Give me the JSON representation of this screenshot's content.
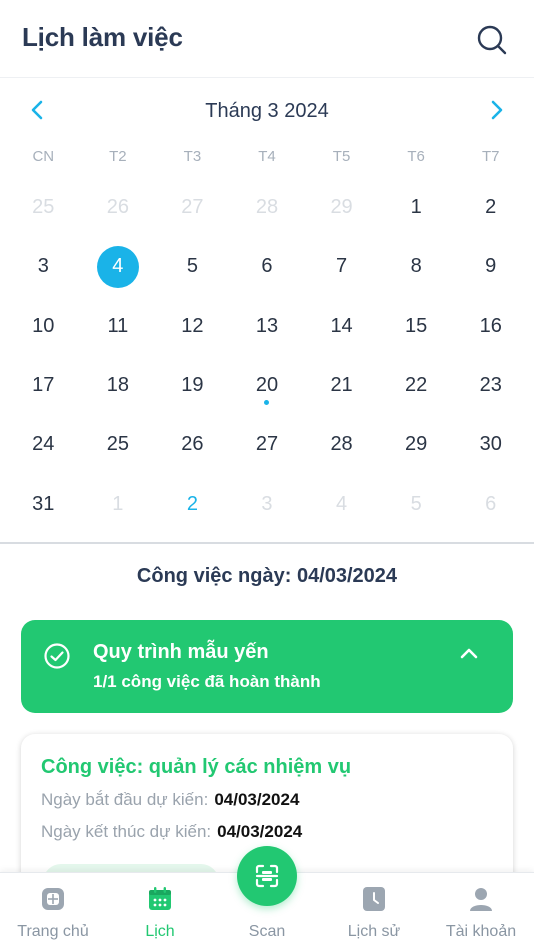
{
  "header": {
    "title": "Lịch làm việc",
    "search_icon": "search-icon"
  },
  "calendar": {
    "month_label": "Tháng 3 2024",
    "weekdays": [
      "CN",
      "T2",
      "T3",
      "T4",
      "T5",
      "T6",
      "T7"
    ],
    "days": [
      {
        "label": "25",
        "state": "muted"
      },
      {
        "label": "26",
        "state": "muted"
      },
      {
        "label": "27",
        "state": "muted"
      },
      {
        "label": "28",
        "state": "muted"
      },
      {
        "label": "29",
        "state": "muted"
      },
      {
        "label": "1",
        "state": "normal"
      },
      {
        "label": "2",
        "state": "normal"
      },
      {
        "label": "3",
        "state": "normal"
      },
      {
        "label": "4",
        "state": "selected"
      },
      {
        "label": "5",
        "state": "normal"
      },
      {
        "label": "6",
        "state": "normal"
      },
      {
        "label": "7",
        "state": "normal"
      },
      {
        "label": "8",
        "state": "normal"
      },
      {
        "label": "9",
        "state": "normal"
      },
      {
        "label": "10",
        "state": "normal"
      },
      {
        "label": "11",
        "state": "normal"
      },
      {
        "label": "12",
        "state": "normal"
      },
      {
        "label": "13",
        "state": "normal"
      },
      {
        "label": "14",
        "state": "normal"
      },
      {
        "label": "15",
        "state": "normal"
      },
      {
        "label": "16",
        "state": "normal"
      },
      {
        "label": "17",
        "state": "normal"
      },
      {
        "label": "18",
        "state": "normal"
      },
      {
        "label": "19",
        "state": "normal"
      },
      {
        "label": "20",
        "state": "normal",
        "has_event": true
      },
      {
        "label": "21",
        "state": "normal"
      },
      {
        "label": "22",
        "state": "normal"
      },
      {
        "label": "23",
        "state": "normal"
      },
      {
        "label": "24",
        "state": "normal"
      },
      {
        "label": "25",
        "state": "normal"
      },
      {
        "label": "26",
        "state": "normal"
      },
      {
        "label": "27",
        "state": "normal"
      },
      {
        "label": "28",
        "state": "normal"
      },
      {
        "label": "29",
        "state": "normal"
      },
      {
        "label": "30",
        "state": "normal"
      },
      {
        "label": "31",
        "state": "normal"
      },
      {
        "label": "1",
        "state": "muted"
      },
      {
        "label": "2",
        "state": "accent"
      },
      {
        "label": "3",
        "state": "muted"
      },
      {
        "label": "4",
        "state": "muted"
      },
      {
        "label": "5",
        "state": "muted"
      },
      {
        "label": "6",
        "state": "muted"
      }
    ]
  },
  "day_section": {
    "title": "Công việc ngày: 04/03/2024"
  },
  "process": {
    "title": "Quy trình mẫu yến",
    "subtitle": "1/1 công việc đã hoàn thành"
  },
  "task": {
    "title": "Công việc: quản lý các nhiệm vụ",
    "start_label": "Ngày bắt đầu dự kiến:",
    "start_value": "04/03/2024",
    "end_label": "Ngày kết thúc dự kiến:",
    "end_value": "04/03/2024"
  },
  "bottom_nav": {
    "home": "Trang chủ",
    "calendar": "Lịch",
    "scan": "Scan",
    "history": "Lịch sử",
    "account": "Tài khoản"
  },
  "colors": {
    "accent_blue": "#1ab3e8",
    "accent_green": "#22c872",
    "text_dark": "#2b3a55"
  }
}
